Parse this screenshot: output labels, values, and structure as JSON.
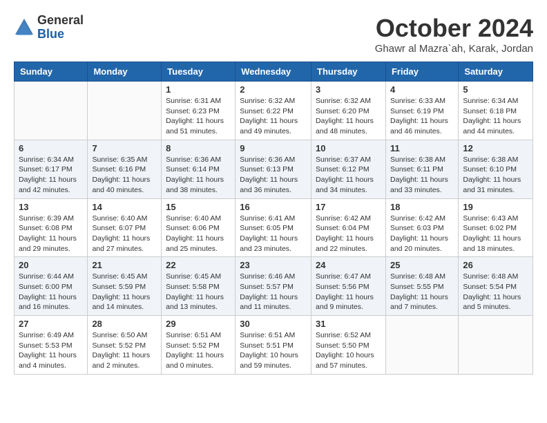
{
  "logo": {
    "general": "General",
    "blue": "Blue"
  },
  "title": {
    "month": "October 2024",
    "location": "Ghawr al Mazra`ah, Karak, Jordan"
  },
  "weekdays": [
    "Sunday",
    "Monday",
    "Tuesday",
    "Wednesday",
    "Thursday",
    "Friday",
    "Saturday"
  ],
  "weeks": [
    [
      {
        "day": null
      },
      {
        "day": null
      },
      {
        "day": 1,
        "sunrise": "Sunrise: 6:31 AM",
        "sunset": "Sunset: 6:23 PM",
        "daylight": "Daylight: 11 hours and 51 minutes."
      },
      {
        "day": 2,
        "sunrise": "Sunrise: 6:32 AM",
        "sunset": "Sunset: 6:22 PM",
        "daylight": "Daylight: 11 hours and 49 minutes."
      },
      {
        "day": 3,
        "sunrise": "Sunrise: 6:32 AM",
        "sunset": "Sunset: 6:20 PM",
        "daylight": "Daylight: 11 hours and 48 minutes."
      },
      {
        "day": 4,
        "sunrise": "Sunrise: 6:33 AM",
        "sunset": "Sunset: 6:19 PM",
        "daylight": "Daylight: 11 hours and 46 minutes."
      },
      {
        "day": 5,
        "sunrise": "Sunrise: 6:34 AM",
        "sunset": "Sunset: 6:18 PM",
        "daylight": "Daylight: 11 hours and 44 minutes."
      }
    ],
    [
      {
        "day": 6,
        "sunrise": "Sunrise: 6:34 AM",
        "sunset": "Sunset: 6:17 PM",
        "daylight": "Daylight: 11 hours and 42 minutes."
      },
      {
        "day": 7,
        "sunrise": "Sunrise: 6:35 AM",
        "sunset": "Sunset: 6:16 PM",
        "daylight": "Daylight: 11 hours and 40 minutes."
      },
      {
        "day": 8,
        "sunrise": "Sunrise: 6:36 AM",
        "sunset": "Sunset: 6:14 PM",
        "daylight": "Daylight: 11 hours and 38 minutes."
      },
      {
        "day": 9,
        "sunrise": "Sunrise: 6:36 AM",
        "sunset": "Sunset: 6:13 PM",
        "daylight": "Daylight: 11 hours and 36 minutes."
      },
      {
        "day": 10,
        "sunrise": "Sunrise: 6:37 AM",
        "sunset": "Sunset: 6:12 PM",
        "daylight": "Daylight: 11 hours and 34 minutes."
      },
      {
        "day": 11,
        "sunrise": "Sunrise: 6:38 AM",
        "sunset": "Sunset: 6:11 PM",
        "daylight": "Daylight: 11 hours and 33 minutes."
      },
      {
        "day": 12,
        "sunrise": "Sunrise: 6:38 AM",
        "sunset": "Sunset: 6:10 PM",
        "daylight": "Daylight: 11 hours and 31 minutes."
      }
    ],
    [
      {
        "day": 13,
        "sunrise": "Sunrise: 6:39 AM",
        "sunset": "Sunset: 6:08 PM",
        "daylight": "Daylight: 11 hours and 29 minutes."
      },
      {
        "day": 14,
        "sunrise": "Sunrise: 6:40 AM",
        "sunset": "Sunset: 6:07 PM",
        "daylight": "Daylight: 11 hours and 27 minutes."
      },
      {
        "day": 15,
        "sunrise": "Sunrise: 6:40 AM",
        "sunset": "Sunset: 6:06 PM",
        "daylight": "Daylight: 11 hours and 25 minutes."
      },
      {
        "day": 16,
        "sunrise": "Sunrise: 6:41 AM",
        "sunset": "Sunset: 6:05 PM",
        "daylight": "Daylight: 11 hours and 23 minutes."
      },
      {
        "day": 17,
        "sunrise": "Sunrise: 6:42 AM",
        "sunset": "Sunset: 6:04 PM",
        "daylight": "Daylight: 11 hours and 22 minutes."
      },
      {
        "day": 18,
        "sunrise": "Sunrise: 6:42 AM",
        "sunset": "Sunset: 6:03 PM",
        "daylight": "Daylight: 11 hours and 20 minutes."
      },
      {
        "day": 19,
        "sunrise": "Sunrise: 6:43 AM",
        "sunset": "Sunset: 6:02 PM",
        "daylight": "Daylight: 11 hours and 18 minutes."
      }
    ],
    [
      {
        "day": 20,
        "sunrise": "Sunrise: 6:44 AM",
        "sunset": "Sunset: 6:00 PM",
        "daylight": "Daylight: 11 hours and 16 minutes."
      },
      {
        "day": 21,
        "sunrise": "Sunrise: 6:45 AM",
        "sunset": "Sunset: 5:59 PM",
        "daylight": "Daylight: 11 hours and 14 minutes."
      },
      {
        "day": 22,
        "sunrise": "Sunrise: 6:45 AM",
        "sunset": "Sunset: 5:58 PM",
        "daylight": "Daylight: 11 hours and 13 minutes."
      },
      {
        "day": 23,
        "sunrise": "Sunrise: 6:46 AM",
        "sunset": "Sunset: 5:57 PM",
        "daylight": "Daylight: 11 hours and 11 minutes."
      },
      {
        "day": 24,
        "sunrise": "Sunrise: 6:47 AM",
        "sunset": "Sunset: 5:56 PM",
        "daylight": "Daylight: 11 hours and 9 minutes."
      },
      {
        "day": 25,
        "sunrise": "Sunrise: 6:48 AM",
        "sunset": "Sunset: 5:55 PM",
        "daylight": "Daylight: 11 hours and 7 minutes."
      },
      {
        "day": 26,
        "sunrise": "Sunrise: 6:48 AM",
        "sunset": "Sunset: 5:54 PM",
        "daylight": "Daylight: 11 hours and 5 minutes."
      }
    ],
    [
      {
        "day": 27,
        "sunrise": "Sunrise: 6:49 AM",
        "sunset": "Sunset: 5:53 PM",
        "daylight": "Daylight: 11 hours and 4 minutes."
      },
      {
        "day": 28,
        "sunrise": "Sunrise: 6:50 AM",
        "sunset": "Sunset: 5:52 PM",
        "daylight": "Daylight: 11 hours and 2 minutes."
      },
      {
        "day": 29,
        "sunrise": "Sunrise: 6:51 AM",
        "sunset": "Sunset: 5:52 PM",
        "daylight": "Daylight: 11 hours and 0 minutes."
      },
      {
        "day": 30,
        "sunrise": "Sunrise: 6:51 AM",
        "sunset": "Sunset: 5:51 PM",
        "daylight": "Daylight: 10 hours and 59 minutes."
      },
      {
        "day": 31,
        "sunrise": "Sunrise: 6:52 AM",
        "sunset": "Sunset: 5:50 PM",
        "daylight": "Daylight: 10 hours and 57 minutes."
      },
      {
        "day": null
      },
      {
        "day": null
      }
    ]
  ]
}
